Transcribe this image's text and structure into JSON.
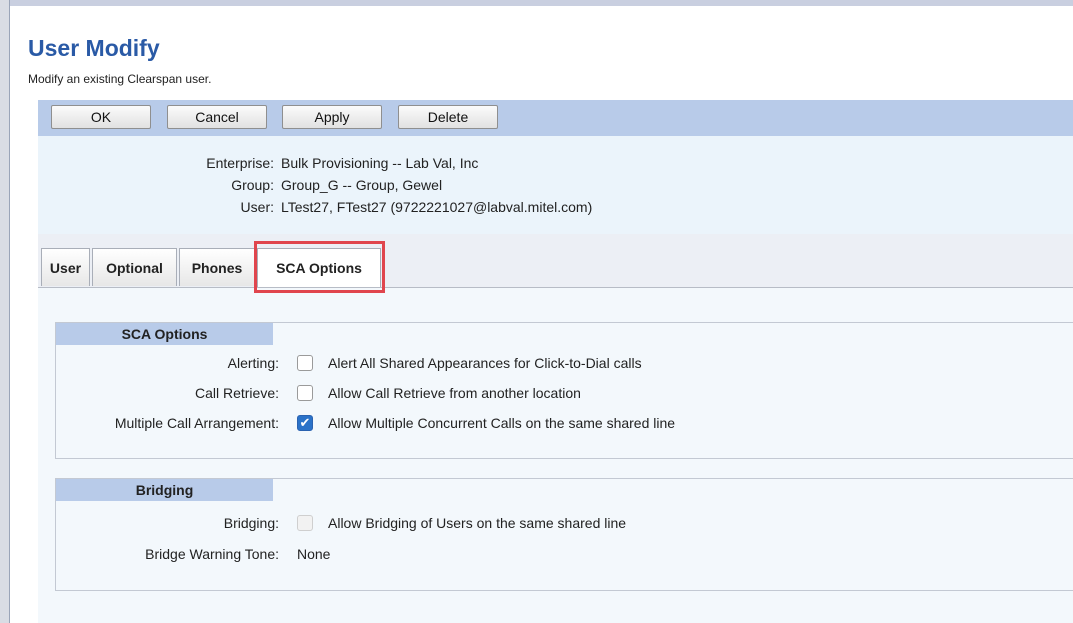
{
  "page": {
    "title": "User Modify",
    "subtitle": "Modify an existing Clearspan user."
  },
  "toolbar": {
    "ok_label": "OK",
    "cancel_label": "Cancel",
    "apply_label": "Apply",
    "delete_label": "Delete"
  },
  "info": {
    "enterprise_label": "Enterprise:",
    "enterprise_value": "Bulk Provisioning -- Lab Val, Inc",
    "group_label": "Group:",
    "group_value": "Group_G -- Group, Gewel",
    "user_label": "User:",
    "user_value": "LTest27, FTest27 (9722221027@labval.mitel.com)"
  },
  "tabs": [
    {
      "label": "User",
      "active": false
    },
    {
      "label": "Optional",
      "active": false
    },
    {
      "label": "Phones",
      "active": false
    },
    {
      "label": "SCA Options",
      "active": true
    }
  ],
  "sca_options": {
    "header": "SCA Options",
    "rows": [
      {
        "label": "Alerting:",
        "text": "Alert All Shared Appearances for Click-to-Dial calls",
        "checked": false
      },
      {
        "label": "Call Retrieve:",
        "text": "Allow Call Retrieve from another location",
        "checked": false
      },
      {
        "label": "Multiple Call Arrangement:",
        "text": "Allow Multiple Concurrent Calls on the same shared line",
        "checked": true
      }
    ]
  },
  "bridging": {
    "header": "Bridging",
    "bridging_label": "Bridging:",
    "bridging_text": "Allow Bridging of Users on the same shared line",
    "bridging_checked": false,
    "bridging_disabled": true,
    "tone_label": "Bridge Warning Tone:",
    "tone_value": "None"
  },
  "colors": {
    "title": "#2a5aa6",
    "toolbar": "#b8cbe9",
    "highlight": "#e0454d",
    "checkbox_checked": "#2a72c8"
  },
  "icons": {
    "checkmark": "check-icon"
  }
}
